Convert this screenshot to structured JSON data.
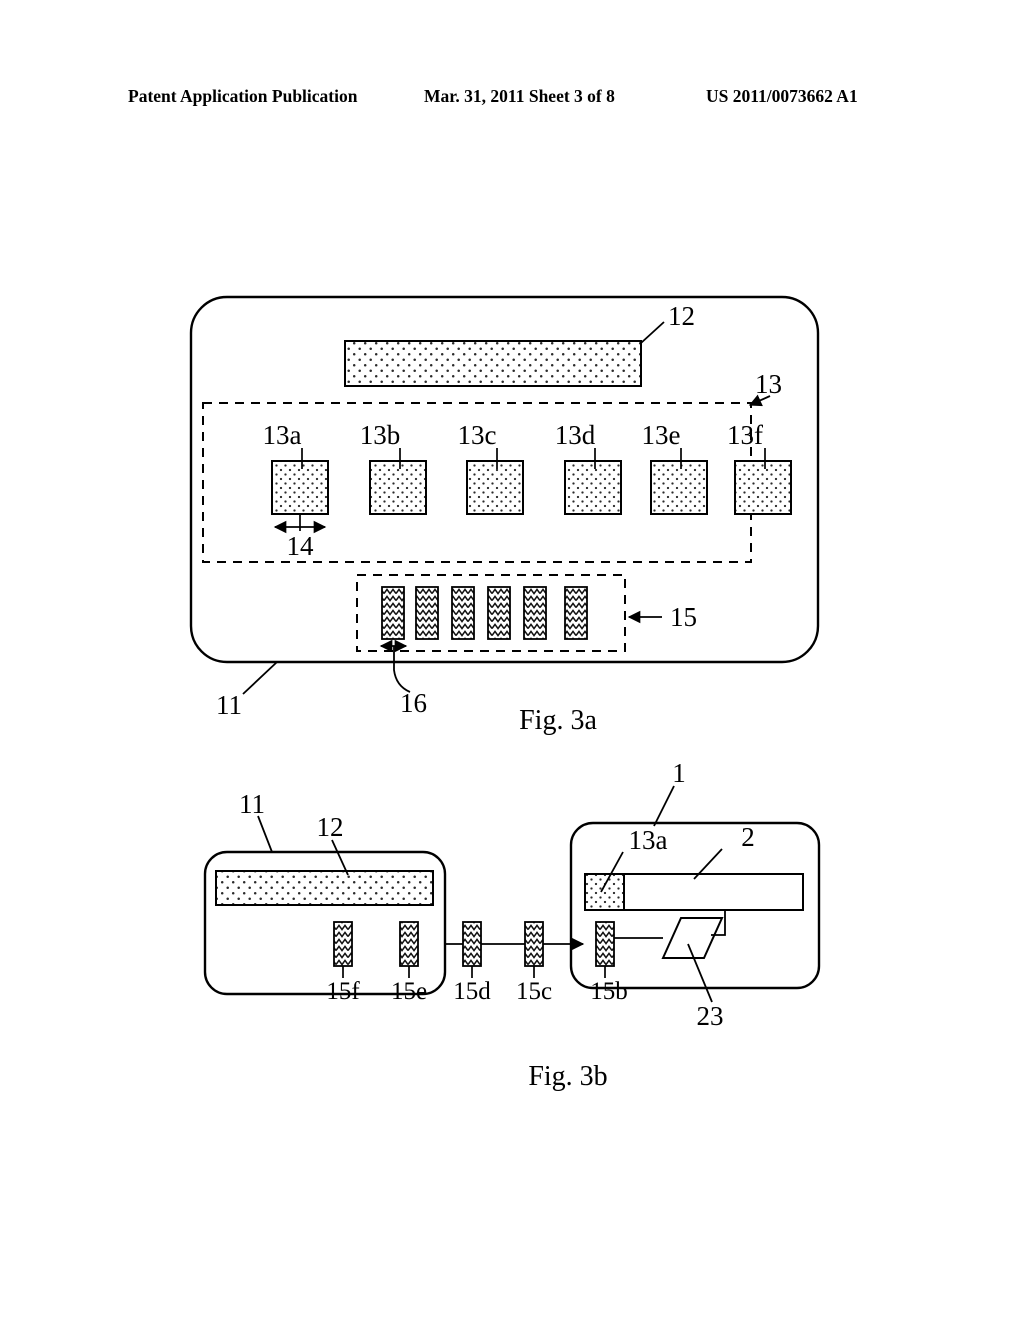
{
  "header": {
    "left": "Patent Application Publication",
    "middle": "Mar. 31, 2011  Sheet 3 of 8",
    "right": "US 2011/0073662 A1"
  },
  "figures": [
    {
      "caption": "Fig. 3a",
      "labels": {
        "device_body": "11",
        "dotted_bar": "12",
        "array_group": "13",
        "cells": [
          "13a",
          "13b",
          "13c",
          "13d",
          "13e",
          "13f"
        ],
        "cell_width": "14",
        "strip_group": "15",
        "strip_width": "16"
      }
    },
    {
      "caption": "Fig. 3b",
      "labels": {
        "left_device": "11",
        "left_dotted_bar": "12",
        "left_strips": [
          "15f",
          "15e"
        ],
        "middle_strips": [
          "15d",
          "15c"
        ],
        "right_device": "1",
        "right_strip": "15b",
        "right_dotted_cell": "13a",
        "right_bar": "2",
        "parallelogram": "23"
      }
    }
  ],
  "colors": {
    "ink": "#000000",
    "paper": "#ffffff",
    "fill_dots": "#fdfdfd",
    "fill_zigzag": "#f2f2f2"
  }
}
